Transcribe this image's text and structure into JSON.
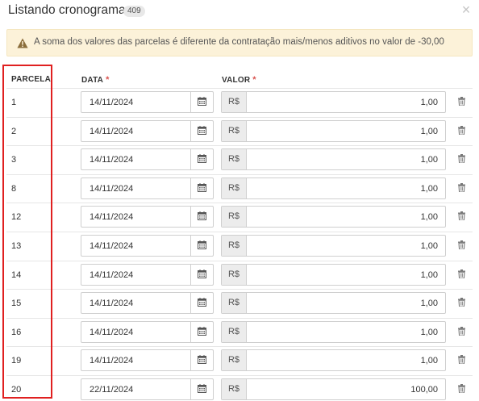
{
  "modal": {
    "title": "Listando cronograma",
    "count": "409",
    "close_icon": "close-icon"
  },
  "alert": {
    "icon": "warning-icon",
    "text": "A soma dos valores das parcelas é diferente da contratação mais/menos aditivos no valor de -30,00"
  },
  "table": {
    "headers": {
      "parcela": "PARCELA",
      "data": "DATA",
      "valor": "VALOR",
      "required_mark": "*"
    },
    "currency_symbol": "R$",
    "rows": [
      {
        "parcela": "1",
        "data": "14/11/2024",
        "valor": "1,00"
      },
      {
        "parcela": "2",
        "data": "14/11/2024",
        "valor": "1,00"
      },
      {
        "parcela": "3",
        "data": "14/11/2024",
        "valor": "1,00"
      },
      {
        "parcela": "8",
        "data": "14/11/2024",
        "valor": "1,00"
      },
      {
        "parcela": "12",
        "data": "14/11/2024",
        "valor": "1,00"
      },
      {
        "parcela": "13",
        "data": "14/11/2024",
        "valor": "1,00"
      },
      {
        "parcela": "14",
        "data": "14/11/2024",
        "valor": "1,00"
      },
      {
        "parcela": "15",
        "data": "14/11/2024",
        "valor": "1,00"
      },
      {
        "parcela": "16",
        "data": "14/11/2024",
        "valor": "1,00"
      },
      {
        "parcela": "19",
        "data": "14/11/2024",
        "valor": "1,00"
      },
      {
        "parcela": "20",
        "data": "22/11/2024",
        "valor": "100,00"
      }
    ]
  },
  "colors": {
    "alert_bg": "#fcf2d9",
    "required": "#d9534f",
    "highlight_border": "#e02020"
  }
}
